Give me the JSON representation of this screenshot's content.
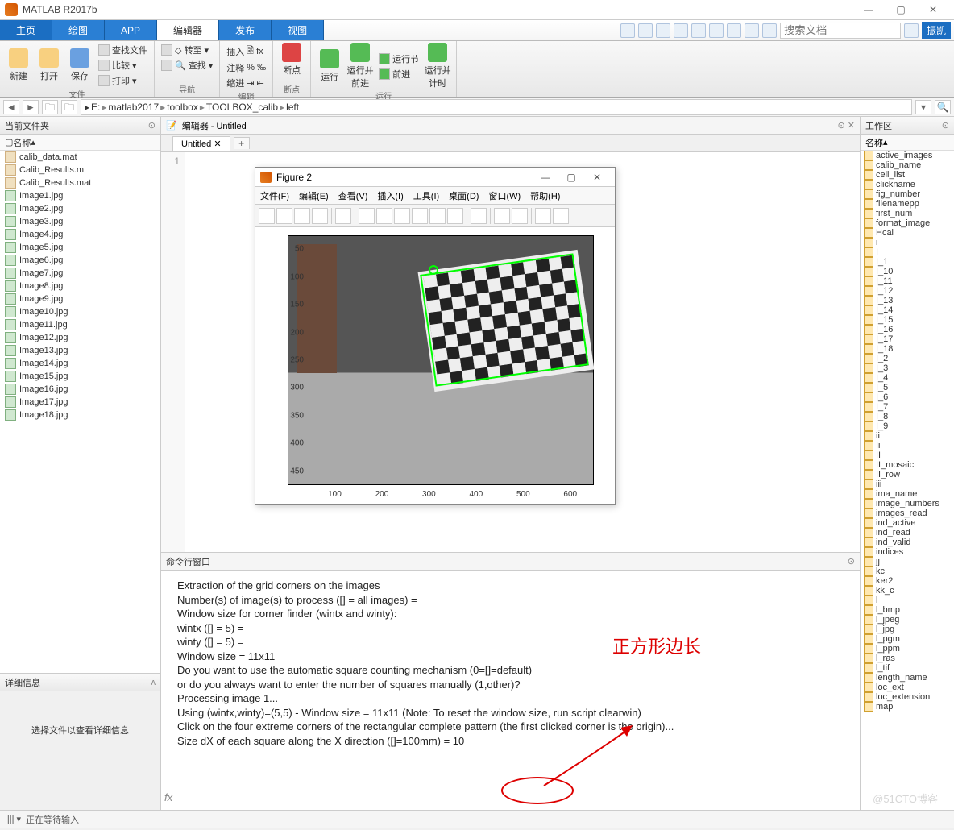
{
  "window": {
    "title": "MATLAB R2017b",
    "min": "—",
    "max": "▢",
    "close": "✕"
  },
  "tabs": {
    "home": "主页",
    "plots": "绘图",
    "apps": "APP",
    "editor": "编辑器",
    "publish": "发布",
    "view": "视图"
  },
  "search": {
    "placeholder": "搜索文档",
    "user": "振凯"
  },
  "ribbon": {
    "file_group": "文件",
    "nav_group": "导航",
    "edit_group": "编辑",
    "bp_group": "断点",
    "run_group": "运行",
    "new": "新建",
    "open": "打开",
    "save": "保存",
    "find": "查找文件",
    "compare": "比较",
    "print": "打印",
    "goto": "转至",
    "search": "查找",
    "insert": "插入",
    "comment": "注释",
    "indent": "缩进",
    "fx": "fx",
    "breakpoints": "断点",
    "run": "运行",
    "run_advance": "运行并前进",
    "advance": "前进",
    "run_section": "运行节",
    "run_time": "运行并计时"
  },
  "path": {
    "root": "E:",
    "p1": "matlab2017",
    "p2": "toolbox",
    "p3": "TOOLBOX_calib",
    "p4": "left"
  },
  "curfolder": {
    "title": "当前文件夹",
    "col": "名称",
    "files": [
      "calib_data.mat",
      "Calib_Results.m",
      "Calib_Results.mat",
      "Image1.jpg",
      "Image2.jpg",
      "Image3.jpg",
      "Image4.jpg",
      "Image5.jpg",
      "Image6.jpg",
      "Image7.jpg",
      "Image8.jpg",
      "Image9.jpg",
      "Image10.jpg",
      "Image11.jpg",
      "Image12.jpg",
      "Image13.jpg",
      "Image14.jpg",
      "Image15.jpg",
      "Image16.jpg",
      "Image17.jpg",
      "Image18.jpg"
    ]
  },
  "detail": {
    "title": "详细信息",
    "msg": "选择文件以查看详细信息"
  },
  "editor": {
    "title": "编辑器 - Untitled",
    "tab": "Untitled",
    "line1": "1"
  },
  "cmd": {
    "title": "命令行窗口",
    "lines": [
      "",
      "Extraction of the grid corners on the images",
      "Number(s) of image(s) to process ([] = all images) =",
      "Window size for corner finder (wintx and winty):",
      "wintx ([] = 5) =",
      "winty ([] = 5) =",
      "Window size = 11x11",
      "Do you want to use the automatic square counting mechanism (0=[]=default)",
      "   or do you always want to enter the number of squares manually (1,other)?",
      "",
      "Processing image 1...",
      "Using (wintx,winty)=(5,5) - Window size = 11x11      (Note: To reset the window size, run script clearwin)",
      "Click on the four extreme corners of the rectangular complete pattern (the first clicked corner is the origin)...",
      "Size dX of each square along the X direction ([]=100mm) = 10"
    ],
    "fx": "fx"
  },
  "workspace": {
    "title": "工作区",
    "col": "名称",
    "vars": [
      "active_images",
      "calib_name",
      "cell_list",
      "clickname",
      "fig_number",
      "filenamepp",
      "first_num",
      "format_image",
      "Hcal",
      "i",
      "I",
      "I_1",
      "I_10",
      "I_11",
      "I_12",
      "I_13",
      "I_14",
      "I_15",
      "I_16",
      "I_17",
      "I_18",
      "I_2",
      "I_3",
      "I_4",
      "I_5",
      "I_6",
      "I_7",
      "I_8",
      "I_9",
      "ii",
      "Ii",
      "II",
      "II_mosaic",
      "II_row",
      "iii",
      "ima_name",
      "image_numbers",
      "images_read",
      "ind_active",
      "ind_read",
      "ind_valid",
      "indices",
      "jj",
      "kc",
      "ker2",
      "kk_c",
      "l",
      "l_bmp",
      "l_jpeg",
      "l_jpg",
      "l_pgm",
      "l_ppm",
      "l_ras",
      "l_tif",
      "length_name",
      "loc_ext",
      "loc_extension",
      "map"
    ]
  },
  "figure": {
    "title": "Figure 2",
    "menu": [
      "文件(F)",
      "编辑(E)",
      "查看(V)",
      "插入(I)",
      "工具(I)",
      "桌面(D)",
      "窗口(W)",
      "帮助(H)"
    ],
    "yticks": [
      "50",
      "100",
      "150",
      "200",
      "250",
      "300",
      "350",
      "400",
      "450"
    ],
    "xticks": [
      "100",
      "200",
      "300",
      "400",
      "500",
      "600"
    ]
  },
  "status": {
    "text": "正在等待输入"
  },
  "annotation": {
    "text": "正方形边长"
  },
  "watermark": "@51CTO博客"
}
